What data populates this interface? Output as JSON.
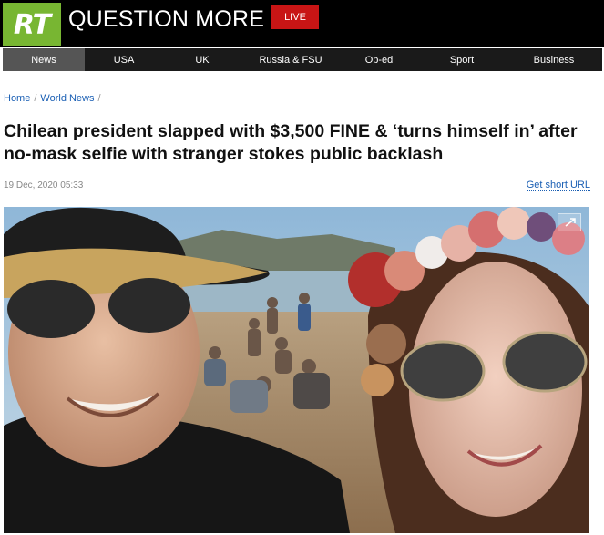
{
  "header": {
    "logo_text": "RT",
    "slogan": "QUESTION MORE",
    "live_label": "LIVE"
  },
  "nav": {
    "items": [
      "News",
      "USA",
      "UK",
      "Russia & FSU",
      "Op-ed",
      "Sport",
      "Business"
    ],
    "active": "News"
  },
  "breadcrumb": {
    "home": "Home",
    "section": "World News",
    "sep": "/"
  },
  "article": {
    "title": "Chilean president slapped with $3,500 FINE & ‘turns himself in’ after no-mask selfie with stranger stokes public backlash",
    "date": "19 Dec, 2020 05:33",
    "short_url_label": "Get short URL"
  },
  "colors": {
    "brand_green": "#78b632",
    "live_red": "#c81515",
    "link_blue": "#1a5fb4"
  },
  "icons": {
    "expand": "expand-icon"
  }
}
